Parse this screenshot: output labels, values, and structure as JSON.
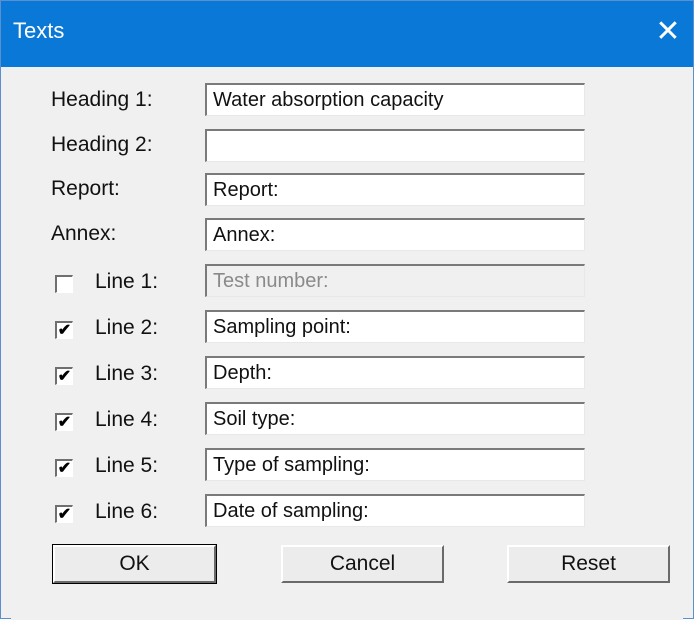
{
  "window": {
    "title": "Texts",
    "close_glyph": "✕"
  },
  "fields": {
    "heading1": {
      "label": "Heading 1:",
      "value": "Water absorption capacity"
    },
    "heading2": {
      "label": "Heading 2:",
      "value": ""
    },
    "report": {
      "label": "Report:",
      "value": "Report:"
    },
    "annex": {
      "label": "Annex:",
      "value": "Annex:"
    }
  },
  "lines": [
    {
      "label": "Line 1:",
      "checked": false,
      "value": "Test number:",
      "enabled": false
    },
    {
      "label": "Line 2:",
      "checked": true,
      "value": "Sampling point:",
      "enabled": true
    },
    {
      "label": "Line 3:",
      "checked": true,
      "value": "Depth:",
      "enabled": true
    },
    {
      "label": "Line 4:",
      "checked": true,
      "value": "Soil type:",
      "enabled": true
    },
    {
      "label": "Line 5:",
      "checked": true,
      "value": "Type of sampling:",
      "enabled": true
    },
    {
      "label": "Line 6:",
      "checked": true,
      "value": "Date of sampling:",
      "enabled": true
    }
  ],
  "checkbox_glyph": "✔",
  "buttons": {
    "ok": "OK",
    "cancel": "Cancel",
    "reset": "Reset"
  },
  "colors": {
    "titlebar": "#0a78d6",
    "dialog_bg": "#f0f0f0"
  }
}
